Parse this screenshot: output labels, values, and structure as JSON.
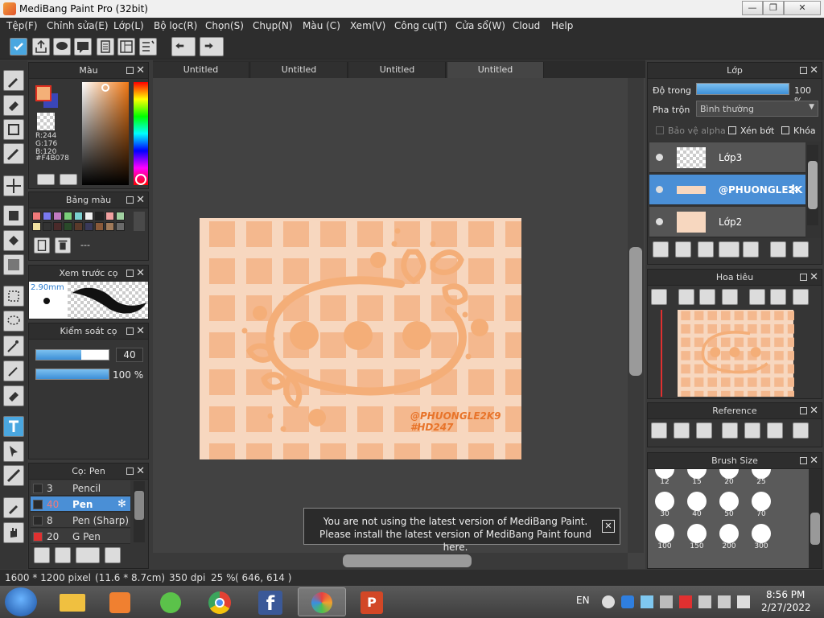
{
  "window": {
    "title": "MediBang Paint Pro (32bit)",
    "min": "—",
    "max": "❐",
    "close": "✕"
  },
  "menu": [
    "Tệp(F)",
    "Chỉnh sửa(E)",
    "Lớp(L)",
    "Bộ lọc(R)",
    "Chọn(S)",
    "Chụp(N)",
    "Màu (C)",
    "Xem(V)",
    "Công cụ(T)",
    "Cửa sổ(W)",
    "Cloud",
    "Help"
  ],
  "color_panel": {
    "title": "Màu",
    "r": "R:244",
    "g": "G:176",
    "b": "B:120",
    "hex": "#F4B078",
    "fg_color": "#F4B078"
  },
  "palette_panel": {
    "title": "Bảng màu",
    "empty": "---"
  },
  "brush_preview": {
    "title": "Xem trước cọ",
    "size": "2.90mm"
  },
  "brush_control": {
    "title": "Kiểm soát cọ",
    "size_value": "40",
    "opacity_value": "100 %"
  },
  "brush_list": {
    "title": "Cọ: Pen",
    "items": [
      {
        "size": "3",
        "name": "Pencil",
        "color": "#2a2a2a"
      },
      {
        "size": "40",
        "name": "Pen",
        "color": "#2a2a2a"
      },
      {
        "size": "8",
        "name": "Pen (Sharp)",
        "color": "#2a2a2a"
      },
      {
        "size": "20",
        "name": "G Pen",
        "color": "#e03030"
      }
    ]
  },
  "tabs": [
    "Untitled",
    "Untitled",
    "Untitled",
    "Untitled"
  ],
  "artwork": {
    "watermark_line1": "@PHUONGLE2K9",
    "watermark_line2": "#HD247"
  },
  "update_notice": {
    "line1": "You are not using the latest version of MediBang Paint.",
    "line2": "Please install the latest version of MediBang Paint found here.",
    "close": "✕"
  },
  "layer_panel": {
    "title": "Lớp",
    "opacity_label": "Độ trong",
    "opacity_value": "100 %",
    "blend_label": "Pha trộn",
    "blend_value": "Bình thường",
    "protect_alpha": "Bảo vệ alpha",
    "clipping": "Xén bớt",
    "lock": "Khóa",
    "layers": [
      {
        "name": "Lớp3",
        "selected": false
      },
      {
        "name": "@PHUONGLE2K",
        "selected": true
      },
      {
        "name": "Lớp2",
        "selected": false
      }
    ]
  },
  "navigator": {
    "title": "Hoa tiêu"
  },
  "reference": {
    "title": "Reference"
  },
  "brush_size": {
    "title": "Brush Size",
    "sizes": [
      "12",
      "15",
      "20",
      "25",
      "30",
      "40",
      "50",
      "70",
      "100",
      "150",
      "200",
      "300"
    ]
  },
  "status": {
    "dimensions": "1600 * 1200 pixel",
    "physical": "(11.6 * 8.7cm)",
    "dpi": "350 dpi",
    "zoom": "25 %",
    "cursor": "( 646, 614 )"
  },
  "taskbar": {
    "lang": "EN",
    "time": "8:56 PM",
    "date": "2/27/2022"
  },
  "colors": {
    "accent": "#4a8fd6",
    "art_bg": "#F7D7BF",
    "art_check": "#F4B88E",
    "art_line": "#F4AE78",
    "watermark": "#E8742A"
  }
}
